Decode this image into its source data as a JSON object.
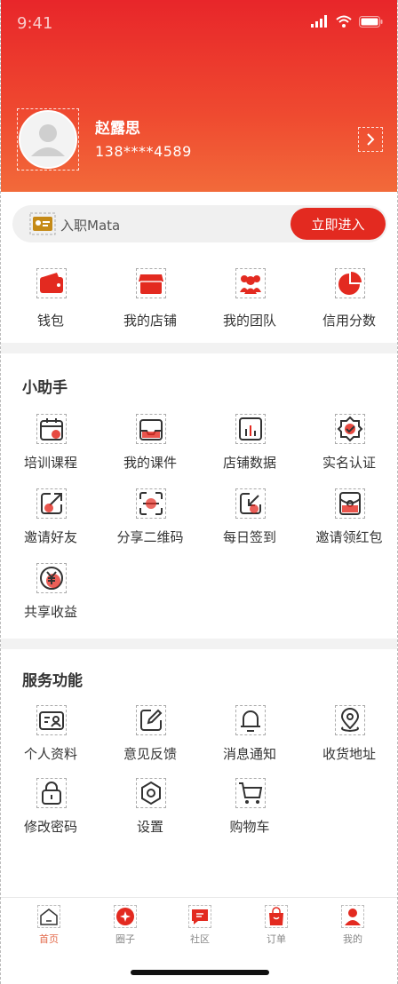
{
  "status_bar": {
    "time": "9:41"
  },
  "profile": {
    "name": "赵露思",
    "phone": "138****4589"
  },
  "join": {
    "text": "入职Mata",
    "button": "立即进入"
  },
  "quick_actions": [
    {
      "label": "钱包",
      "icon": "wallet-icon"
    },
    {
      "label": "我的店铺",
      "icon": "store-icon"
    },
    {
      "label": "我的团队",
      "icon": "team-icon"
    },
    {
      "label": "信用分数",
      "icon": "pie-chart-icon"
    }
  ],
  "assistant": {
    "title": "小助手",
    "items": [
      {
        "label": "培训课程",
        "icon": "calendar-icon"
      },
      {
        "label": "我的课件",
        "icon": "inbox-icon"
      },
      {
        "label": "店铺数据",
        "icon": "bar-chart-icon"
      },
      {
        "label": "实名认证",
        "icon": "verified-badge-icon"
      },
      {
        "label": "邀请好友",
        "icon": "share-arrow-icon"
      },
      {
        "label": "分享二维码",
        "icon": "scan-icon"
      },
      {
        "label": "每日签到",
        "icon": "sign-in-icon"
      },
      {
        "label": "邀请领红包",
        "icon": "red-envelope-icon"
      },
      {
        "label": "共享收益",
        "icon": "yen-coin-icon"
      }
    ]
  },
  "services": {
    "title": "服务功能",
    "items": [
      {
        "label": "个人资料",
        "icon": "id-card-icon"
      },
      {
        "label": "意见反馈",
        "icon": "edit-icon"
      },
      {
        "label": "消息通知",
        "icon": "bell-icon"
      },
      {
        "label": "收货地址",
        "icon": "location-icon"
      },
      {
        "label": "修改密码",
        "icon": "lock-icon"
      },
      {
        "label": "设置",
        "icon": "settings-icon"
      },
      {
        "label": "购物车",
        "icon": "cart-icon"
      }
    ]
  },
  "tabbar": [
    {
      "label": "首页",
      "icon": "home-icon",
      "active": true
    },
    {
      "label": "圈子",
      "icon": "circle-icon",
      "active": false
    },
    {
      "label": "社区",
      "icon": "chat-icon",
      "active": false
    },
    {
      "label": "订单",
      "icon": "bag-icon",
      "active": false
    },
    {
      "label": "我的",
      "icon": "user-icon",
      "active": false
    }
  ],
  "colors": {
    "primary": "#e32a20",
    "header_top": "#e8262a",
    "header_bottom": "#f26a3a",
    "accent_tab": "#e36b4c"
  }
}
